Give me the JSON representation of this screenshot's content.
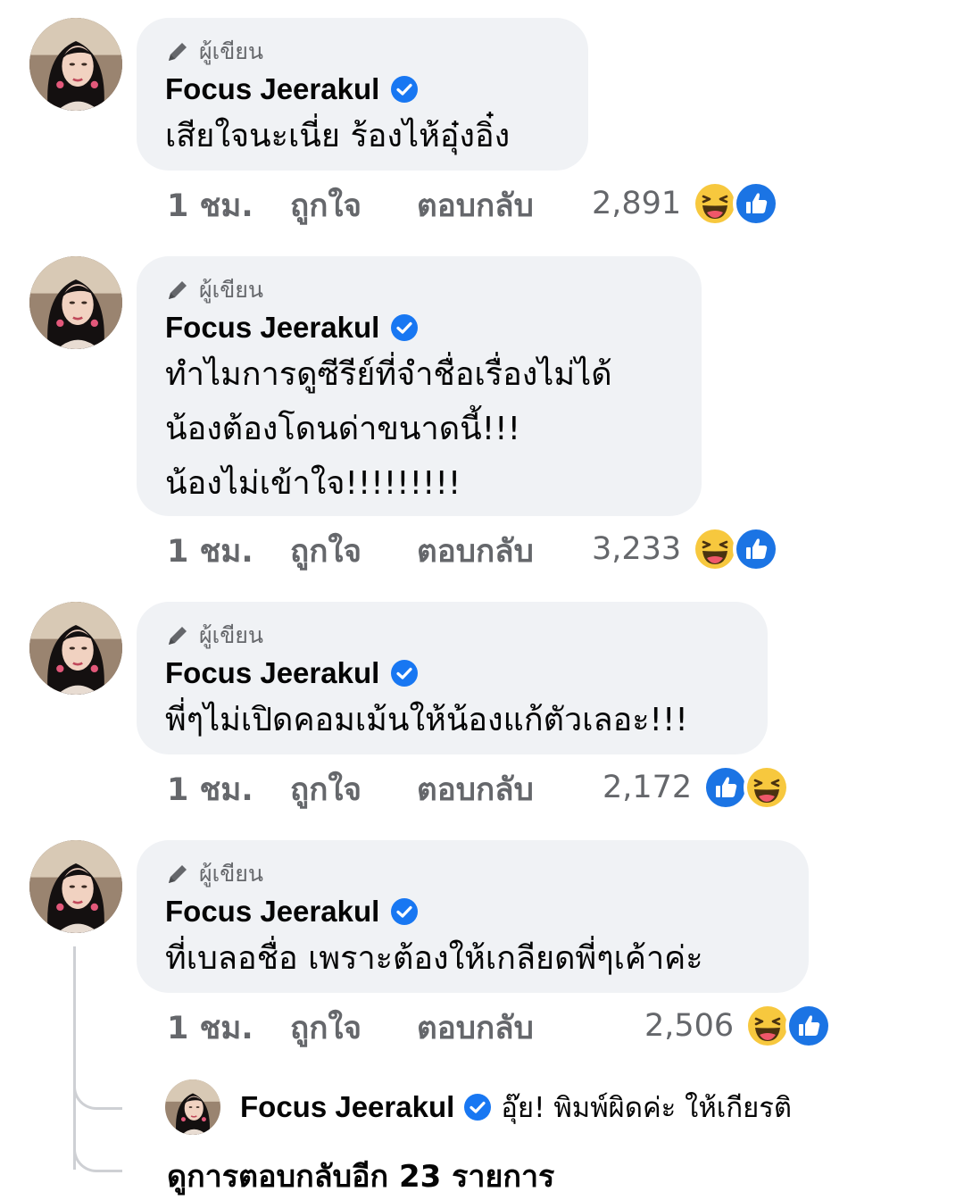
{
  "comments": [
    {
      "author_badge": "ผู้เขียน",
      "author": "Focus Jeerakul",
      "text": "เสียใจนะเนี่ย ร้องไห้อุ๋งอิ๋ง",
      "time": "1 ชม.",
      "like_label": "ถูกใจ",
      "reply_label": "ตอบกลับ",
      "reaction_count": "2,891",
      "reactions": [
        "haha-icon",
        "like-icon"
      ]
    },
    {
      "author_badge": "ผู้เขียน",
      "author": "Focus Jeerakul",
      "text": "ทำไมการดูซีรีย์ที่จำชื่อเรื่องไม่ได้\nน้องต้องโดนด่าขนาดนี้!!!\nน้องไม่เข้าใจ!!!!!!!!!",
      "time": "1 ชม.",
      "like_label": "ถูกใจ",
      "reply_label": "ตอบกลับ",
      "reaction_count": "3,233",
      "reactions": [
        "haha-icon",
        "like-icon"
      ]
    },
    {
      "author_badge": "ผู้เขียน",
      "author": "Focus Jeerakul",
      "text": "พี่ๆไม่เปิดคอมเม้นให้น้องแก้ตัวเลอะ!!!",
      "time": "1 ชม.",
      "like_label": "ถูกใจ",
      "reply_label": "ตอบกลับ",
      "reaction_count": "2,172",
      "reactions": [
        "like-icon",
        "haha-icon"
      ]
    },
    {
      "author_badge": "ผู้เขียน",
      "author": "Focus Jeerakul",
      "text": "ที่เบลอชื่อ เพราะต้องให้เกลียดพี่ๆเค้าค่ะ",
      "time": "1 ชม.",
      "like_label": "ถูกใจ",
      "reply_label": "ตอบกลับ",
      "reaction_count": "2,506",
      "reactions": [
        "haha-icon",
        "like-icon"
      ]
    }
  ],
  "reply_preview": {
    "author": "Focus Jeerakul",
    "text": "อุ๊ย! พิมพ์ผิดค่ะ ให้เกียรติ"
  },
  "more_replies_label": "ดูการตอบกลับอีก 23 รายการ",
  "colors": {
    "bubble": "#f0f2f5",
    "secondary_text": "#65676b",
    "verified_blue": "#1877f2",
    "haha_yellow": "#f7c83e"
  }
}
